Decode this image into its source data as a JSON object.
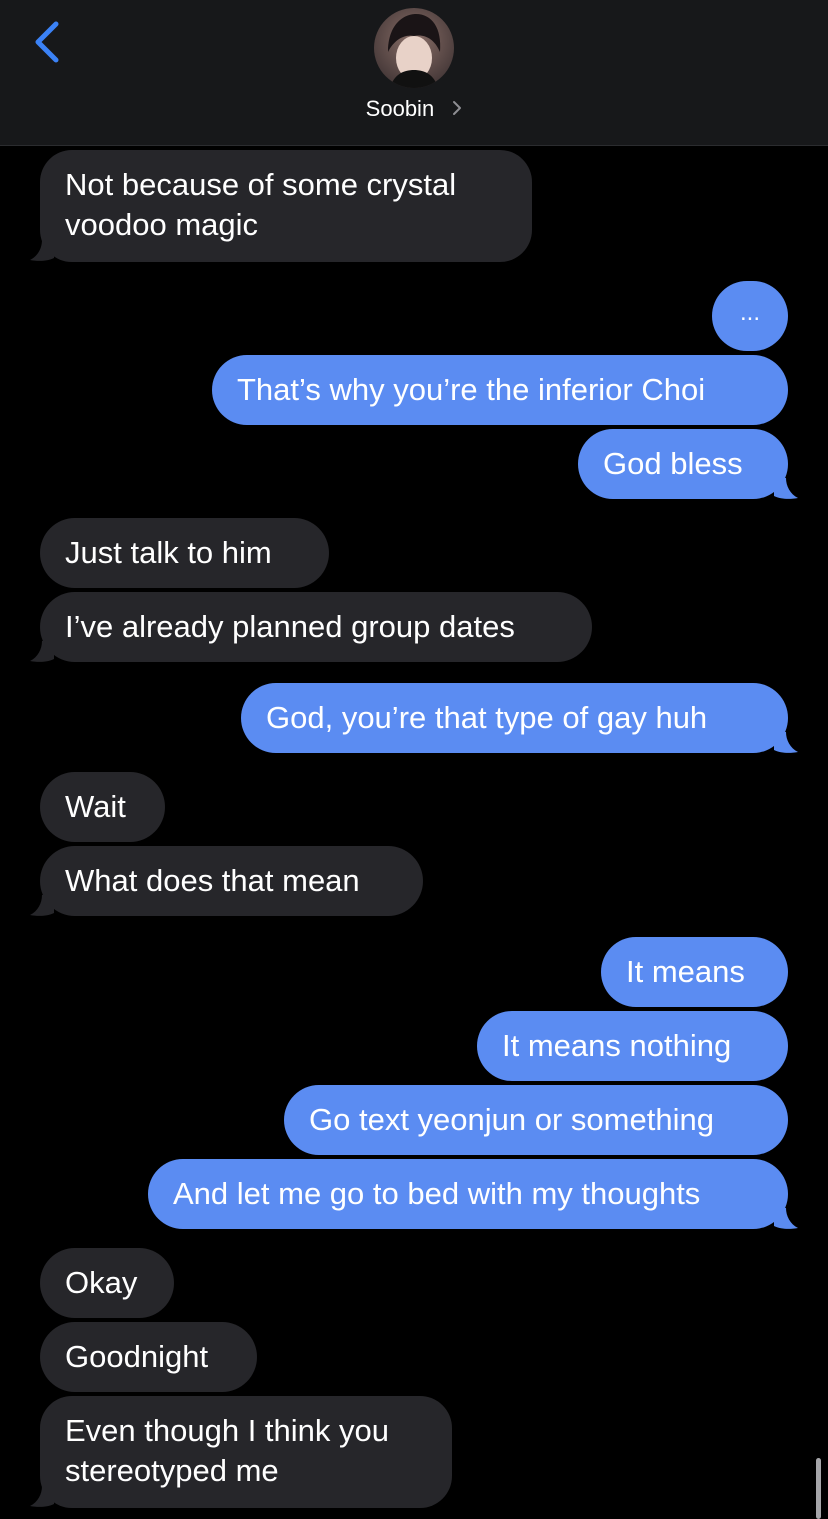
{
  "header": {
    "contact_name": "Soobin",
    "back_icon": "chevron-left-icon",
    "accent_color": "#3b82f6"
  },
  "colors": {
    "incoming_bubble": "#26262a",
    "outgoing_bubble": "#5b8cf2",
    "background": "#000000"
  },
  "messages": [
    {
      "direction": "incoming",
      "text": "Not because of some crystal voodoo magic"
    },
    {
      "direction": "outgoing",
      "text": "..."
    },
    {
      "direction": "outgoing",
      "text": "That’s why you’re the inferior Choi"
    },
    {
      "direction": "outgoing",
      "text": "God bless"
    },
    {
      "direction": "incoming",
      "text": "Just talk to him"
    },
    {
      "direction": "incoming",
      "text": "I’ve already planned group dates"
    },
    {
      "direction": "outgoing",
      "text": "God, you’re that type of gay huh"
    },
    {
      "direction": "incoming",
      "text": "Wait"
    },
    {
      "direction": "incoming",
      "text": "What does that mean"
    },
    {
      "direction": "outgoing",
      "text": "It means"
    },
    {
      "direction": "outgoing",
      "text": "It means nothing"
    },
    {
      "direction": "outgoing",
      "text": "Go text yeonjun or something"
    },
    {
      "direction": "outgoing",
      "text": "And let me go to bed with my thoughts"
    },
    {
      "direction": "incoming",
      "text": "Okay"
    },
    {
      "direction": "incoming",
      "text": "Goodnight"
    },
    {
      "direction": "incoming",
      "text": "Even though I think you stereotyped me"
    }
  ],
  "msg0_line1": "Not because of some crystal",
  "msg0_line2": "voodoo magic",
  "msg15_line1": "Even though I think you",
  "msg15_line2": "stereotyped me"
}
